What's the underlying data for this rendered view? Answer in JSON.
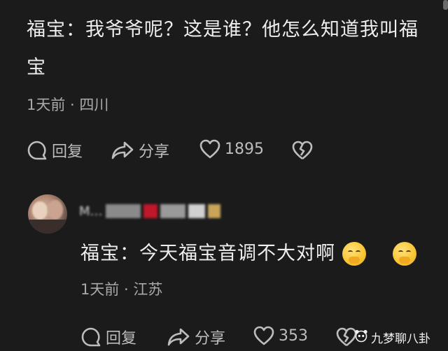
{
  "comment1": {
    "text_line1": "福宝：我爷爷呢？这是谁？他怎么知道我叫福",
    "text_line2": "宝",
    "meta": "1天前 · 四川",
    "reply_label": "回复",
    "share_label": "分享",
    "like_count": "1895"
  },
  "comment2": {
    "author_name": "M…",
    "text": "福宝：今天福宝音调不大对啊",
    "meta": "1天前 · 江苏",
    "reply_label": "回复",
    "share_label": "分享",
    "like_count": "353"
  },
  "watermark": {
    "text": "九梦聊八卦"
  },
  "colors": {
    "background": "#1b1b1b",
    "text_primary": "#ededed",
    "text_secondary": "#a9a9a9"
  }
}
